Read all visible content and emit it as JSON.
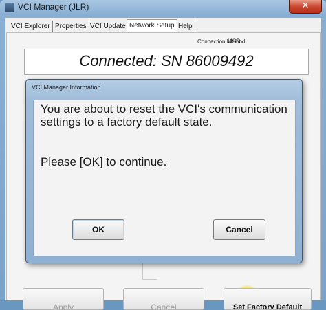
{
  "window": {
    "title": "VCI Manager (JLR)",
    "close_glyph": "✕"
  },
  "tabs": [
    {
      "label": "VCI Explorer"
    },
    {
      "label": "Properties"
    },
    {
      "label": "VCI Update"
    },
    {
      "label": "Network Setup",
      "active": true
    },
    {
      "label": "Help"
    }
  ],
  "connection": {
    "method_label": "Connection Method:",
    "method_value": "USB",
    "status": "Connected: SN 86009492"
  },
  "bottom_buttons": {
    "apply": "Apply",
    "cancel": "Cancel",
    "set_factory_default": "Set Factory Default"
  },
  "dialog": {
    "title": "VCI Manager Information",
    "message": "You are about to reset the VCI's communication settings to a factory default state.",
    "instruction": "Please [OK] to continue.",
    "ok_label": "OK",
    "cancel_label": "Cancel"
  }
}
